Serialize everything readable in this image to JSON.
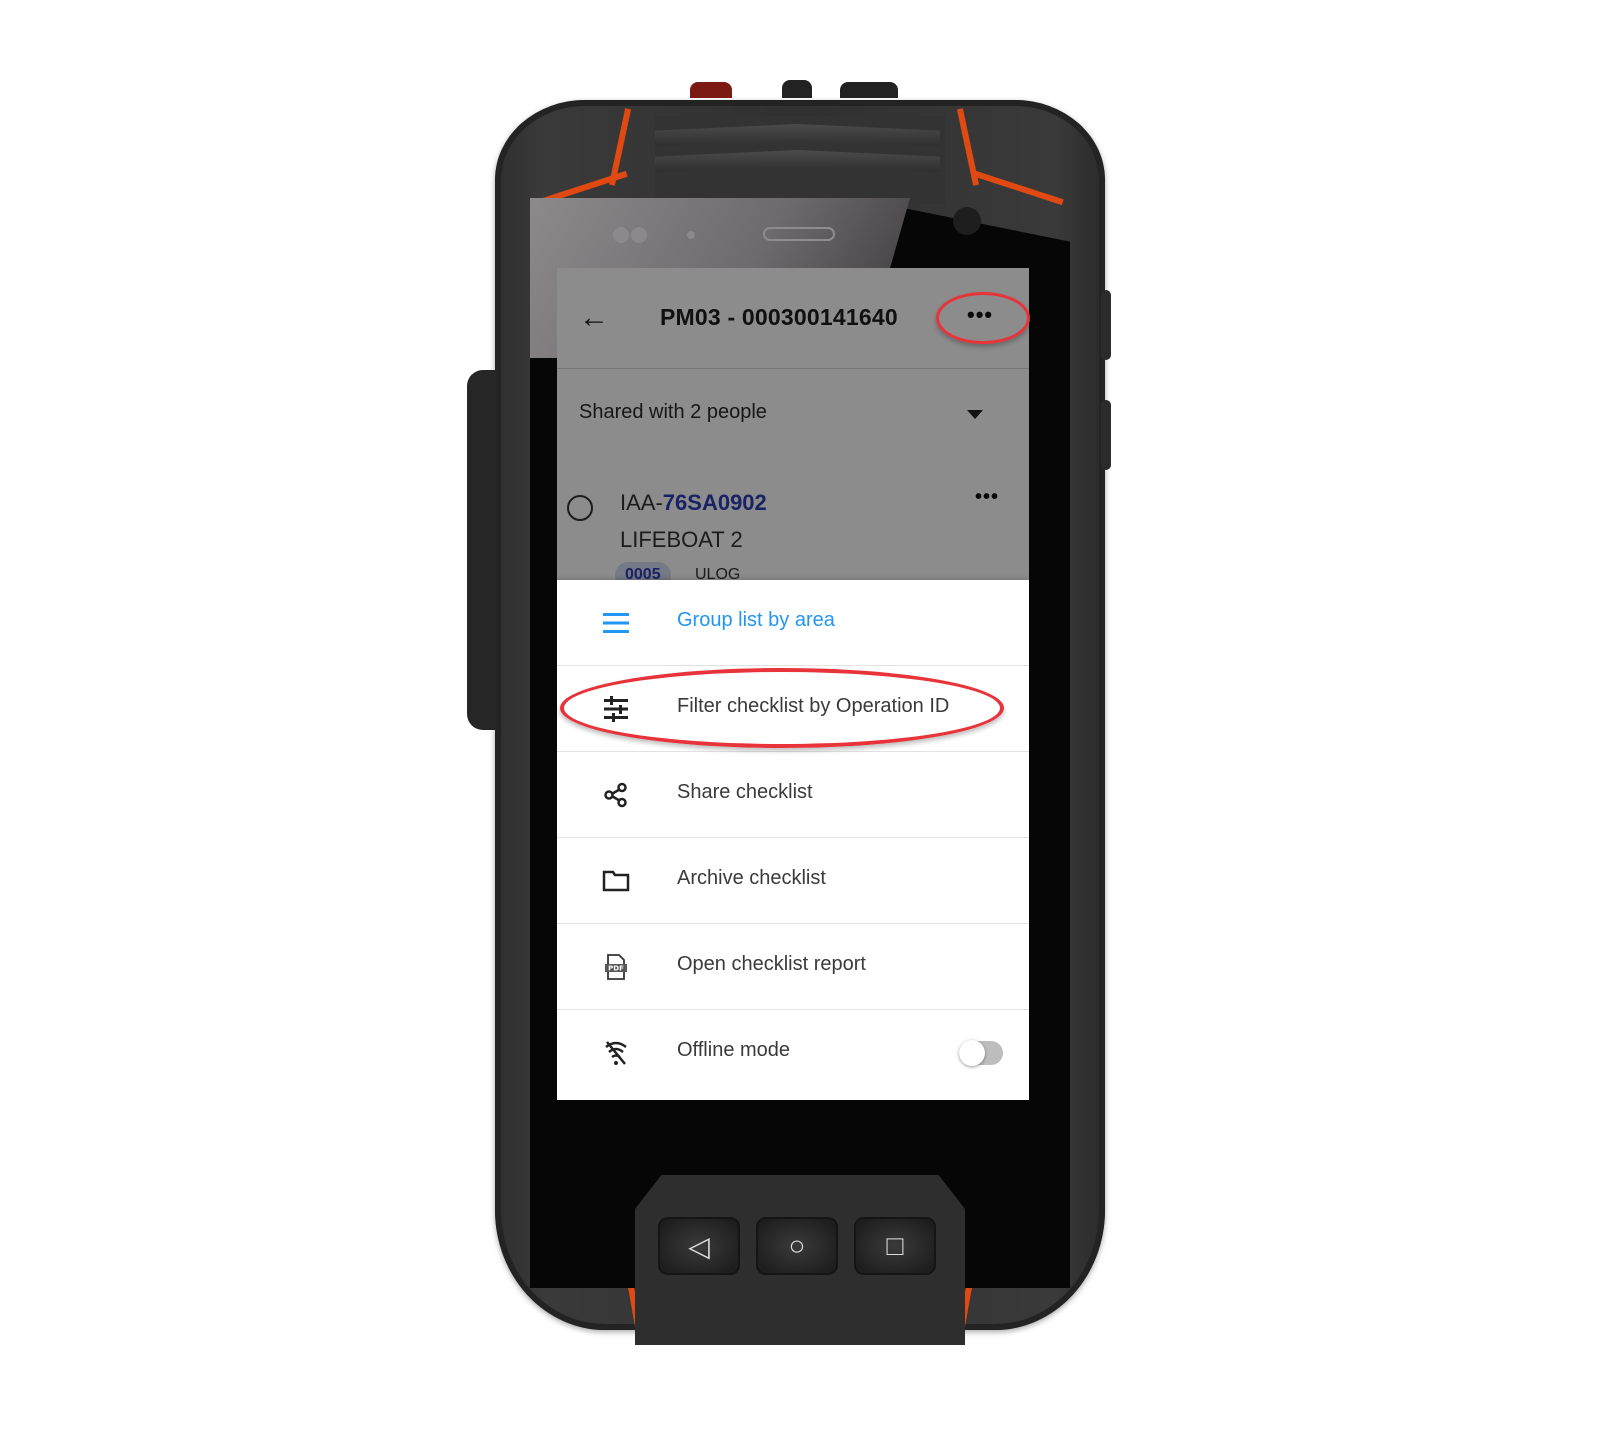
{
  "device": {
    "nav_keys": [
      {
        "name": "back",
        "glyph": "◁"
      },
      {
        "name": "home",
        "glyph": "○"
      },
      {
        "name": "recents",
        "glyph": "□"
      }
    ],
    "accent_color": "#e04a12"
  },
  "app_bar": {
    "back_icon": "←",
    "title": "PM03 - 000300141640",
    "more_icon": "•••"
  },
  "shared": {
    "label": "Shared with 2 people"
  },
  "checklist_item": {
    "id_prefix": "IAA-",
    "id_code": "76SA0902",
    "name": "LIFEBOAT 2",
    "more_icon": "•••",
    "chip": "0005",
    "chip_secondary": "ULOG"
  },
  "menu": {
    "items": [
      {
        "label": "Group list by area",
        "icon": "list-icon",
        "active": true
      },
      {
        "label": "Filter checklist by Operation ID",
        "icon": "tune-icon",
        "active": false
      },
      {
        "label": "Share checklist",
        "icon": "share-icon",
        "active": false
      },
      {
        "label": "Archive checklist",
        "icon": "folder-icon",
        "active": false
      },
      {
        "label": "Open checklist report",
        "icon": "pdf-icon",
        "active": false
      },
      {
        "label": "Offline mode",
        "icon": "wifi-off-icon",
        "active": false,
        "toggle_on": false
      }
    ]
  },
  "colors": {
    "menu_active": "#2196f3",
    "id_blue": "#2f3fb7",
    "annotation_red": "#e8333a"
  }
}
